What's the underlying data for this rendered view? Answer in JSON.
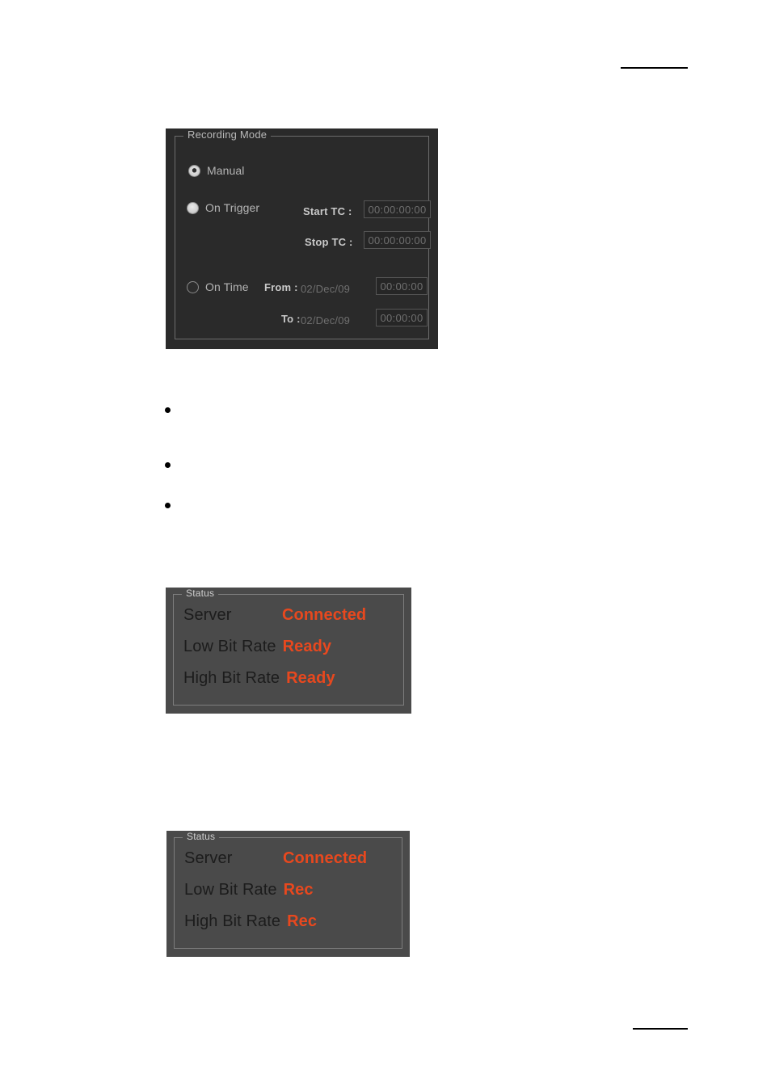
{
  "page": {
    "rules": {
      "top_rule": "",
      "bottom_rule": ""
    },
    "bullets": [
      {
        "text": ""
      },
      {
        "text": ""
      },
      {
        "text": ""
      }
    ]
  },
  "recording_mode_panel": {
    "legend": "Recording Mode",
    "options": [
      {
        "id": "manual",
        "label": "Manual",
        "state": "selected"
      },
      {
        "id": "on-trigger",
        "label": "On Trigger",
        "state": "filled"
      },
      {
        "id": "on-time",
        "label": "On Time",
        "state": "empty"
      }
    ],
    "fields": {
      "start_tc": {
        "label": "Start TC :",
        "value": "00:00:00:00"
      },
      "stop_tc": {
        "label": "Stop TC :",
        "value": "00:00:00:00"
      },
      "from": {
        "label": "From :",
        "date_value": "02/Dec/09",
        "time_value": "00:00:00"
      },
      "to": {
        "label": "To :",
        "date_value": "02/Dec/09",
        "time_value": "00:00:00"
      }
    },
    "colors": {
      "panel_bg": "#2a2a2a",
      "border": "#6c6c6c",
      "label_text": "#b4b4b4",
      "field_text": "#6f6f6f"
    }
  },
  "status_panel_ready": {
    "legend": "Status",
    "rows": [
      {
        "label": "Server",
        "value": "Connected"
      },
      {
        "label": "Low Bit Rate",
        "value": "Ready"
      },
      {
        "label": "High Bit Rate",
        "value": "Ready"
      }
    ],
    "colors": {
      "panel_bg": "#4a4a4a",
      "label_text": "#1c1c1c",
      "value_text": "#e8481e"
    }
  },
  "status_panel_rec": {
    "legend": "Status",
    "rows": [
      {
        "label": "Server",
        "value": "Connected"
      },
      {
        "label": "Low Bit Rate",
        "value": "Rec"
      },
      {
        "label": "High Bit Rate",
        "value": "Rec"
      }
    ],
    "colors": {
      "panel_bg": "#4a4a4a",
      "label_text": "#1c1c1c",
      "value_text": "#e8481e"
    }
  }
}
